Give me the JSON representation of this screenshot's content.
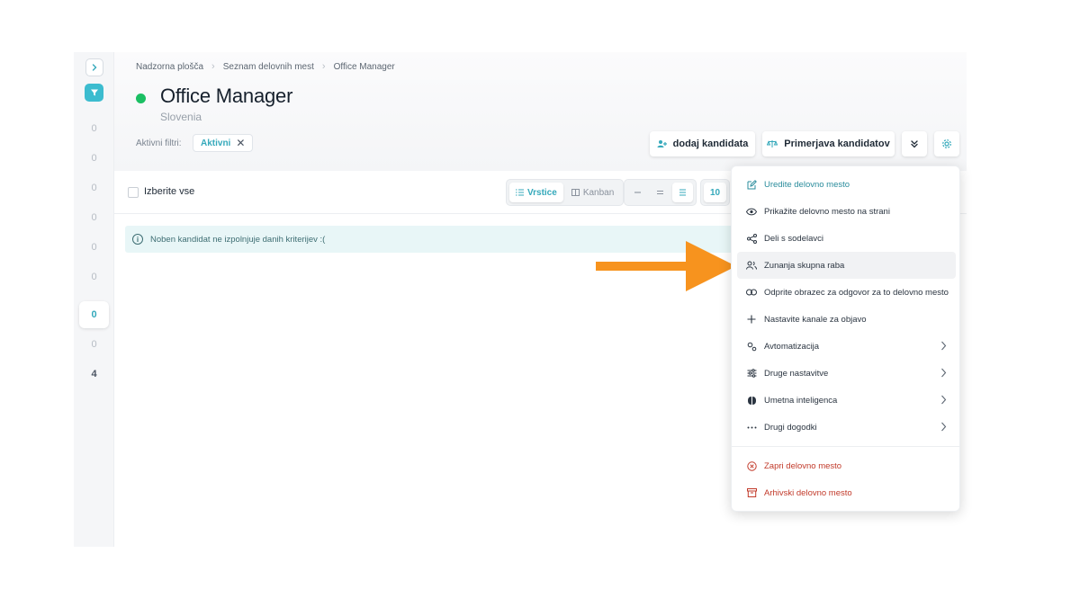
{
  "breadcrumb": {
    "items": [
      "Nadzorna plošča",
      "Seznam delovnih mest",
      "Office Manager"
    ]
  },
  "job": {
    "title": "Office Manager",
    "location": "Slovenia"
  },
  "filters": {
    "label": "Aktivni filtri:",
    "chip": "Aktivni"
  },
  "rail": {
    "counts": [
      "0",
      "0",
      "0",
      "0",
      "0",
      "0",
      "0",
      "0",
      "4"
    ]
  },
  "actions": {
    "add_candidate": "dodaj kandidata",
    "compare_candidates": "Primerjava kandidatov"
  },
  "toolbar": {
    "select_all": "Izberite vse",
    "view_rows": "Vrstice",
    "view_kanban": "Kanban",
    "page_size": "10"
  },
  "banner": {
    "text": "Noben kandidat ne izpolnjuje danih kriterijev :("
  },
  "menu": {
    "items": [
      {
        "label": "Uredite delovno mesto",
        "icon": "edit-icon"
      },
      {
        "label": "Prikažite delovno mesto na strani",
        "icon": "eye-icon"
      },
      {
        "label": "Deli s sodelavci",
        "icon": "share-icon"
      },
      {
        "label": "Zunanja skupna raba",
        "icon": "users-icon"
      },
      {
        "label": "Odprite obrazec za odgovor za to delovno mesto",
        "icon": "link-icon"
      },
      {
        "label": "Nastavite kanale za objavo",
        "icon": "plus-icon"
      },
      {
        "label": "Avtomatizacija",
        "icon": "automation-icon"
      },
      {
        "label": "Druge nastavitve",
        "icon": "sliders-icon"
      },
      {
        "label": "Umetna inteligenca",
        "icon": "ai-icon"
      },
      {
        "label": "Drugi dogodki",
        "icon": "more-icon"
      }
    ],
    "danger_items": [
      {
        "label": "Zapri delovno mesto",
        "icon": "close-circle-icon"
      },
      {
        "label": "Arhivski delovno mesto",
        "icon": "archive-icon"
      }
    ]
  },
  "colors": {
    "accent": "#35a9bb",
    "status_active": "#1bbf63",
    "danger": "#c23a2a",
    "annotation_arrow": "#f7931e"
  }
}
